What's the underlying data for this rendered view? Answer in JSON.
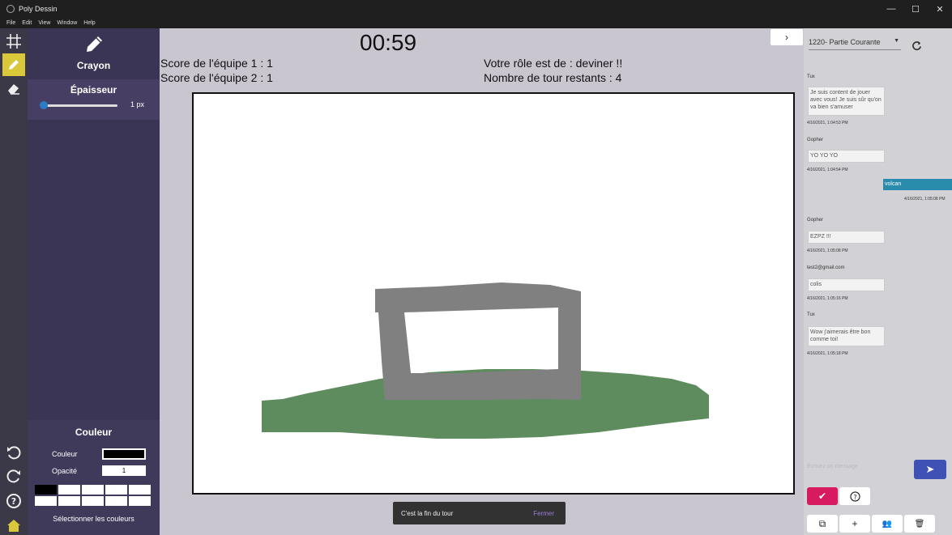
{
  "window": {
    "title": "Poly Dessin",
    "menu": [
      "File",
      "Edit",
      "View",
      "Window",
      "Help"
    ],
    "controls": [
      "—",
      "☐",
      "✕"
    ]
  },
  "toolrail": {
    "tools": [
      {
        "name": "grid-icon",
        "glyph": "#"
      },
      {
        "name": "pencil-tool-icon",
        "glyph": "✎"
      },
      {
        "name": "eraser-icon",
        "glyph": "⌫"
      }
    ],
    "bottom": [
      {
        "name": "undo-icon",
        "glyph": "↶"
      },
      {
        "name": "redo-icon",
        "glyph": "↷"
      },
      {
        "name": "help-icon",
        "glyph": "?"
      },
      {
        "name": "home-icon",
        "glyph": "⌂"
      }
    ]
  },
  "leftpanel": {
    "tool_label": "Crayon",
    "thickness_title": "Épaisseur",
    "thickness_value": "1 px",
    "thickness_fraction": 0.0,
    "color_title": "Couleur",
    "color_label": "Couleur",
    "opacity_label": "Opacité",
    "opacity_value": "1",
    "select_colors": "Sélectionner les couleurs",
    "current_color": "#000000"
  },
  "game": {
    "timer": "00:59",
    "score_team1": "Score de l'équipe 1 : 1",
    "score_team2": "Score de l'équipe 2 : 1",
    "role": "Votre rôle est de : deviner !!",
    "rounds_left": "Nombre de tour restants : 4",
    "collapse_glyph": "›"
  },
  "snackbar": {
    "message": "C'est la fin du tour",
    "action": "Fermer"
  },
  "chat": {
    "channel": "1220- Partie Courante",
    "messages": [
      {
        "user": "Tux",
        "text": "Je suis content de jouer avec vous! Je suis sûr qu'on va bien s'amuser",
        "time": "4/16/2021, 1:04:53 PM"
      },
      {
        "user": "Gopher",
        "text": "YO YO YO",
        "time": "4/16/2021, 1:04:54 PM"
      },
      {
        "user": "Gopher",
        "text": "EZPZ !!!",
        "time": "4/16/2021, 1:05:08 PM"
      },
      {
        "user": "test2@gmail.com",
        "text": "colis",
        "time": "4/16/2021, 1:05:16 PM"
      },
      {
        "user": "Tux",
        "text": "Wow j'aimerais être bon comme toi!",
        "time": "4/16/2021, 1:05:18 PM"
      }
    ],
    "own_message": {
      "text": "volcan",
      "time": "4/16/2021, 1:05:08 PM"
    },
    "input_placeholder": "Écrivez un message",
    "send_glyph": "➤",
    "check_glyph": "✔",
    "bottom_actions": [
      {
        "name": "open-external-icon",
        "glyph": "⧉"
      },
      {
        "name": "add-icon",
        "glyph": "+"
      },
      {
        "name": "add-group-icon",
        "glyph": "👥"
      },
      {
        "name": "delete-icon",
        "glyph": "🗑"
      }
    ]
  },
  "colors": {
    "canvas_drawing_gray": "#808080",
    "canvas_drawing_green": "#5e8c5e",
    "accent_pink": "#d81b60",
    "accent_blue": "#3f51b5",
    "own_bubble": "#2a8cac",
    "active_tool": "#d8c83a"
  }
}
